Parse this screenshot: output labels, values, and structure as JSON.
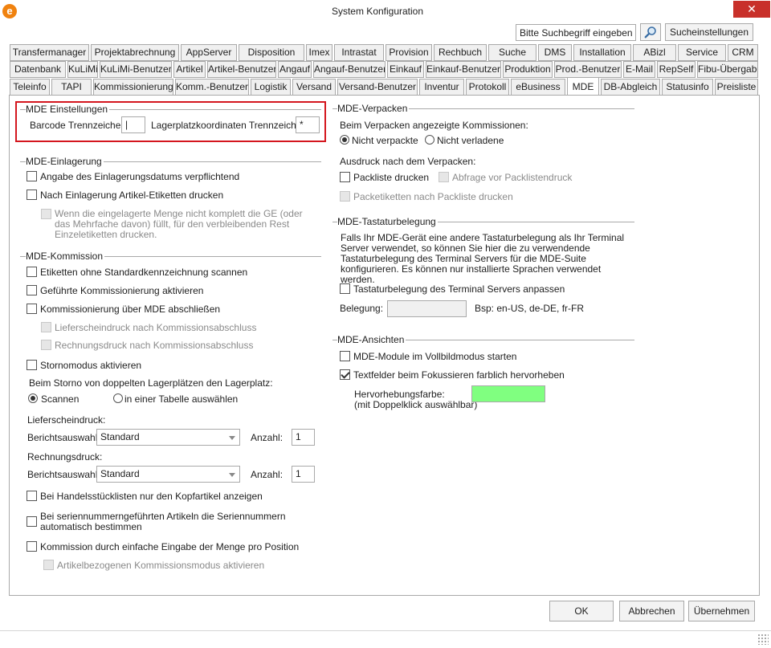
{
  "window": {
    "title": "System Konfiguration",
    "close_glyph": "✕",
    "app_icon_glyph": "e",
    "app_icon": "app-logo-icon"
  },
  "search": {
    "value": "Bitte Suchbegriff eingeben",
    "button_icon": "magnifier-icon",
    "settings_label": "Sucheinstellungen"
  },
  "tabs": {
    "row1": [
      "Transfermanager",
      "Projektabrechnung",
      "AppServer",
      "Disposition",
      "Imex",
      "Intrastat",
      "Provision",
      "Rechbuch",
      "Suche",
      "DMS",
      "Installation",
      "ABizl",
      "Service",
      "CRM"
    ],
    "row2": [
      "Datenbank",
      "KuLiMi",
      "KuLiMi-Benutzer",
      "Artikel",
      "Artikel-Benutzer",
      "Angauf",
      "Angauf-Benutzer",
      "Einkauf",
      "Einkauf-Benutzer",
      "Produktion",
      "Prod.-Benutzer",
      "E-Mail",
      "RepSelf",
      "Fibu-Übergabe"
    ],
    "row3": [
      "Teleinfo",
      "TAPI",
      "Kommissionierung",
      "Komm.-Benutzer",
      "Logistik",
      "Versand",
      "Versand-Benutzer",
      "Inventur",
      "Protokoll",
      "eBusiness",
      "MDE",
      "DB-Abgleich",
      "Statusinfo",
      "Preisliste"
    ],
    "active": "MDE"
  },
  "mde_einstellungen": {
    "title": "MDE Einstellungen",
    "barcode_label": "Barcode Trennzeichen:",
    "barcode_value": "|",
    "lagerplatz_label": "Lagerplatzkoordinaten Trennzeichen:",
    "lagerplatz_value": "*"
  },
  "einlagerung": {
    "title": "MDE-Einlagerung",
    "items": [
      "Angabe des Einlagerungsdatums verpflichtend",
      "Nach Einlagerung Artikel-Etiketten drucken",
      "Wenn die eingelagerte Menge nicht komplett die GE (oder das Mehrfache davon) füllt, für den verbleibenden Rest Einzeletiketten drucken."
    ]
  },
  "kommission": {
    "title": "MDE-Kommission",
    "items": [
      "Etiketten ohne Standardkennzeichnung scannen",
      "Geführte Kommissionierung aktivieren",
      "Kommissionierung über MDE abschließen",
      "Lieferscheindruck nach Kommissionsabschluss",
      "Rechnungsdruck nach Kommissionsabschluss",
      "Stornomodus aktivieren"
    ],
    "storno_question": "Beim Storno von doppelten Lagerplätzen den Lagerplatz:",
    "radio_scan": "Scannen",
    "radio_table": "in einer Tabelle auswählen",
    "lieferschein_title": "Lieferscheindruck:",
    "rechnung_title": "Rechnungsdruck:",
    "berichtsauswahl_label": "Berichtsauswahl:",
    "lieferschein_bericht": "Standard",
    "rechnung_bericht": "Standard",
    "anzahl_label": "Anzahl:",
    "lieferschein_anzahl": "1",
    "rechnung_anzahl": "1",
    "handel_label": "Bei Handelsstücklisten nur den Kopfartikel anzeigen",
    "serien_label": "Bei seriennummerngeführten Artikeln die Seriennummern automatisch bestimmen",
    "einfache_label": "Kommission durch einfache Eingabe der Menge pro Position",
    "artikelbezogen_label": "Artikelbezogenen Kommissionsmodus aktivieren"
  },
  "verpacken": {
    "title": "MDE-Verpacken",
    "question": "Beim Verpacken angezeigte Kommissionen:",
    "radio_nicht_verpackte": "Nicht verpackte",
    "radio_nicht_verladene": "Nicht verladene",
    "ausdruck_label": "Ausdruck nach dem Verpacken:",
    "packliste": "Packliste drucken",
    "abfrage": "Abfrage vor Packlistendruck",
    "packetiketten": "Packetiketten nach Packliste drucken"
  },
  "tastatur": {
    "title": "MDE-Tastaturbelegung",
    "description": "Falls Ihr MDE-Gerät eine andere Tastaturbelegung als Ihr Terminal Server verwendet, so können Sie hier die zu verwendende Tastaturbelegung des Terminal Servers für die MDE-Suite konfigurieren. Es können nur installierte Sprachen verwendet werden.",
    "anpassen_label": "Tastaturbelegung des Terminal Servers anpassen",
    "belegung_label": "Belegung:",
    "belegung_value": "",
    "example": "Bsp: en-US, de-DE, fr-FR"
  },
  "ansichten": {
    "title": "MDE-Ansichten",
    "vollbild": "MDE-Module im Vollbildmodus starten",
    "textfelder": "Textfelder beim Fokussieren farblich hervorheben",
    "farbe_label": "Hervorhebungsfarbe:",
    "farbe_hint": "(mit Doppelklick auswählbar)",
    "farbe_color": "#80ff80"
  },
  "footer": {
    "ok": "OK",
    "abbrechen": "Abbrechen",
    "uebernehmen": "Übernehmen"
  },
  "colors": {
    "highlight_border": "#d4161e",
    "close_bg": "#c8302a",
    "app_icon": "#f0820f"
  }
}
